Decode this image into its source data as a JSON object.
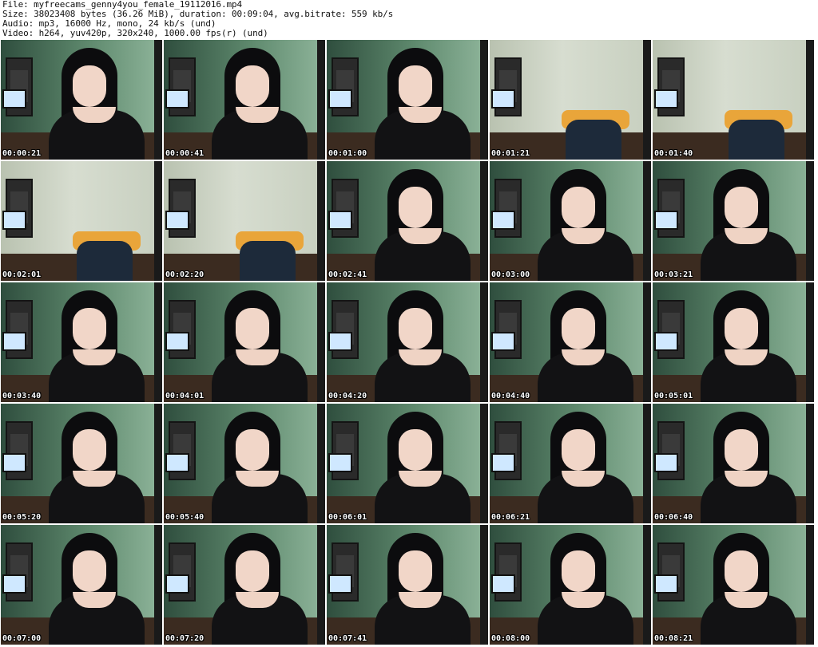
{
  "header": {
    "file": "File: myfreecams_genny4you_female_19112016.mp4",
    "size": "Size: 38023408 bytes (36.26 MiB), duration: 00:09:04, avg.bitrate: 559 kb/s",
    "audio": "Audio: mp3, 16000 Hz, mono, 24 kb/s (und)",
    "video": "Video: h264, yuv420p, 320x240, 1000.00 fps(r) (und)"
  },
  "thumbnails": [
    {
      "time": "00:00:21",
      "scene": "person"
    },
    {
      "time": "00:00:41",
      "scene": "person"
    },
    {
      "time": "00:01:00",
      "scene": "person"
    },
    {
      "time": "00:01:21",
      "scene": "empty"
    },
    {
      "time": "00:01:40",
      "scene": "empty"
    },
    {
      "time": "00:02:01",
      "scene": "empty"
    },
    {
      "time": "00:02:20",
      "scene": "empty"
    },
    {
      "time": "00:02:41",
      "scene": "person"
    },
    {
      "time": "00:03:00",
      "scene": "person"
    },
    {
      "time": "00:03:21",
      "scene": "person"
    },
    {
      "time": "00:03:40",
      "scene": "person"
    },
    {
      "time": "00:04:01",
      "scene": "person"
    },
    {
      "time": "00:04:20",
      "scene": "person"
    },
    {
      "time": "00:04:40",
      "scene": "person"
    },
    {
      "time": "00:05:01",
      "scene": "person"
    },
    {
      "time": "00:05:20",
      "scene": "person"
    },
    {
      "time": "00:05:40",
      "scene": "person"
    },
    {
      "time": "00:06:01",
      "scene": "person"
    },
    {
      "time": "00:06:21",
      "scene": "person"
    },
    {
      "time": "00:06:40",
      "scene": "person"
    },
    {
      "time": "00:07:00",
      "scene": "person"
    },
    {
      "time": "00:07:20",
      "scene": "person"
    },
    {
      "time": "00:07:41",
      "scene": "person"
    },
    {
      "time": "00:08:00",
      "scene": "person"
    },
    {
      "time": "00:08:21",
      "scene": "person"
    }
  ],
  "colors": {
    "wall_green": "#5f8a6e",
    "wall_light": "#cfd8c8",
    "hair": "#0c0c0e",
    "clothing": "#121214",
    "floor": "#3b2b20",
    "timestamp": "#ffffff"
  }
}
